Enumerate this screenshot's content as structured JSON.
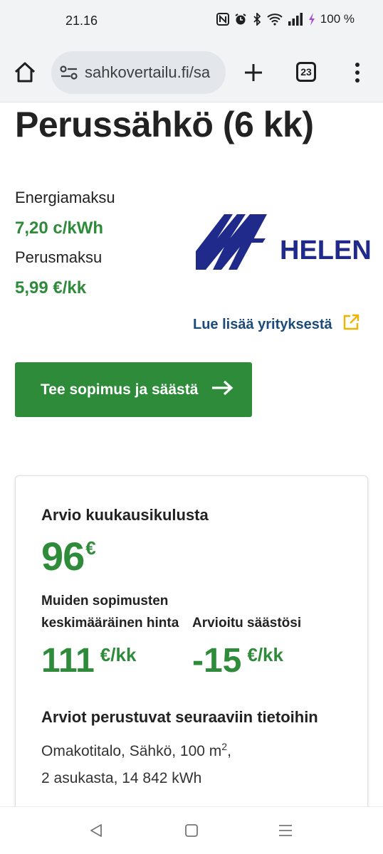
{
  "status_bar": {
    "time": "21.16",
    "battery": "100 %"
  },
  "browser": {
    "url": "sahkovertailu.fi/sa",
    "tab_count": "23"
  },
  "product": {
    "title": "Perussähkö (6 kk)",
    "energy_fee_label": "Energiamaksu",
    "energy_fee_value": "7,20 c/kWh",
    "base_fee_label": "Perusmaksu",
    "base_fee_value": "5,99 €/kk",
    "company_logo_text": "HELEN",
    "company_link": "Lue lisää yrityksestä",
    "cta_label": "Tee sopimus ja säästä"
  },
  "estimate": {
    "heading": "Arvio kuukausikulusta",
    "monthly_value": "96",
    "monthly_unit": "€",
    "others_label_line1": "Muiden sopimusten",
    "others_label_line2": "keskimääräinen hinta",
    "others_value": "111",
    "others_unit": "€/kk",
    "savings_label": "Arvioitu säästösi",
    "savings_value": "-15",
    "savings_unit": "€/kk",
    "basis_heading": "Arviot perustuvat seuraaviin tietoihin",
    "basis_line1_text": "Omakotitalo, Sähkö, 100 m",
    "basis_line1_sup": "2",
    "basis_line1_end": ",",
    "basis_line2": "2 asukasta, 14 842 kWh"
  },
  "colors": {
    "accent_green": "#2e8b3a",
    "link_blue": "#1c4a7a",
    "logo_navy": "#1f2a8a",
    "external_icon": "#f0b400"
  }
}
